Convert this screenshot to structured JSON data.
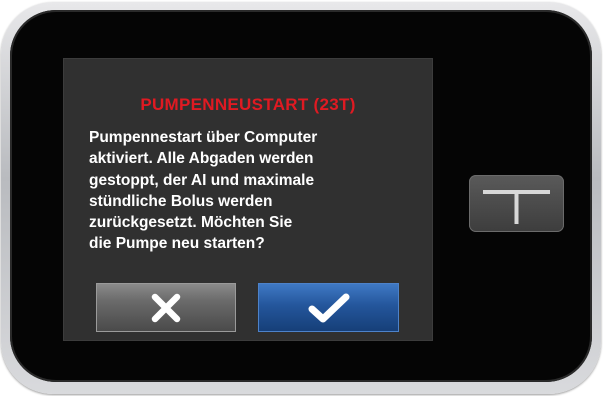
{
  "device": {
    "name": "insulin pump touchscreen",
    "colors": {
      "bezel": "#050505",
      "frame": "#c8c9cc",
      "screen_background": "#303030",
      "title_red": "#e01a22",
      "confirm_blue": "#24569c",
      "cancel_gray": "#6b6b6b"
    }
  },
  "dialog": {
    "title": "PUMPENNEUSTART (23T)",
    "message": "Pumpennestart über Computer\naktiviert. Alle Abgaden werden\ngestoppt, der AI und maximale\nstündliche Bolus werden\nzurückgesetzt. Möchten Sie\ndie Pumpe neu starten?",
    "cancel_icon": "close-x-icon",
    "confirm_icon": "checkmark-icon"
  },
  "hardware": {
    "side_button_icon": "t-logo-icon"
  }
}
